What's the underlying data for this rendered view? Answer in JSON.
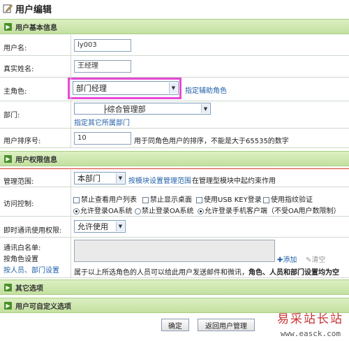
{
  "page": {
    "title": "用户编辑"
  },
  "sections": {
    "basic": "用户基本信息",
    "perm": "用户权限信息",
    "other": "其它选项",
    "custom": "用户可自定义选项"
  },
  "basic": {
    "username_label": "用户名:",
    "username_value": "ly003",
    "realname_label": "真实姓名:",
    "realname_value": "王经理",
    "role_label": "主角色:",
    "role_value": "部门经理",
    "role_aux_link": "指定辅助角色",
    "dept_label": "部门:",
    "dept_value": "├综合管理部",
    "dept_other_link": "指定其它所属部门",
    "order_label": "用户排序号:",
    "order_value": "10",
    "order_note": "用于同角色用户的排序，不能是大于65535的数字"
  },
  "perm": {
    "scope_label": "管理范围:",
    "scope_value": "本部门",
    "scope_link": "按模块设置管理范围",
    "scope_note": "在管理型模块中起约束作用",
    "access_label": "访问控制:",
    "checks": [
      {
        "label": "禁止查看用户列表",
        "checked": false
      },
      {
        "label": "禁止显示桌面",
        "checked": false
      },
      {
        "label": "使用USB KEY登录",
        "checked": false
      },
      {
        "label": "使用指纹验证",
        "checked": false
      }
    ],
    "radios": [
      {
        "label": "允许登录OA系统",
        "checked": true
      },
      {
        "label": "禁止登录OA系统",
        "checked": false
      },
      {
        "label": "允许登录手机客户端（不受OA用户数限制）",
        "checked": true
      }
    ],
    "im_label": "即时通讯使用权限:",
    "im_value": "允许使用",
    "whitelist_label": "通讯白名单:",
    "byrole_label": "按角色设置",
    "byperson_link": "按人员、部门设置",
    "add_link": "添加",
    "clear_link": "清空",
    "whitelist_note": "属于以上所选角色的人员可以给此用户发送邮件和微讯，",
    "whitelist_note_bold": "角色、人员和部门设置均为空"
  },
  "buttons": {
    "confirm": "确定",
    "back": "返回用户管理"
  },
  "watermark": {
    "title": "易采站长站",
    "url": "www.easck.com"
  },
  "colors": {
    "section_bg": "#c3e0a0",
    "highlight": "#e64ad3",
    "link": "#1f5fa8",
    "red_line": "#d83b2b"
  }
}
